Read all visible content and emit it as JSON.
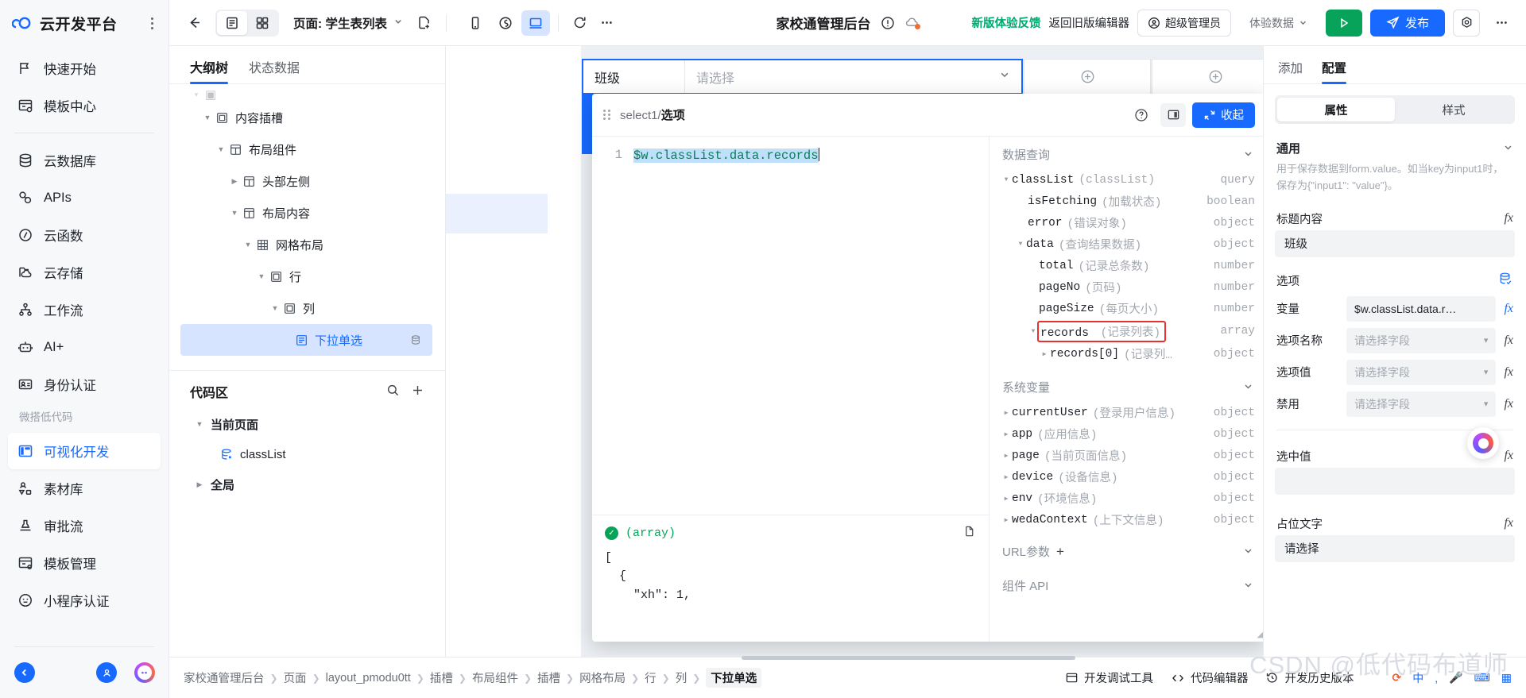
{
  "rail": {
    "brand": "云开发平台",
    "items": [
      {
        "label": "快速开始",
        "icon": "flag-icon"
      },
      {
        "label": "模板中心",
        "icon": "template-icon"
      },
      {
        "label": "云数据库",
        "icon": "database-icon"
      },
      {
        "label": "APIs",
        "icon": "api-link-icon"
      },
      {
        "label": "云函数",
        "icon": "function-icon"
      },
      {
        "label": "云存储",
        "icon": "storage-icon"
      },
      {
        "label": "工作流",
        "icon": "workflow-icon"
      },
      {
        "label": "AI+",
        "icon": "robot-icon"
      },
      {
        "label": "身份认证",
        "icon": "id-card-icon"
      }
    ],
    "group_label": "微搭低代码",
    "lowcode_items": [
      {
        "label": "可视化开发",
        "icon": "layout-icon",
        "active": true
      },
      {
        "label": "素材库",
        "icon": "assets-icon",
        "active": false
      },
      {
        "label": "审批流",
        "icon": "approval-icon",
        "active": false
      },
      {
        "label": "模板管理",
        "icon": "template-manage-icon",
        "active": false
      },
      {
        "label": "小程序认证",
        "icon": "miniprogram-icon",
        "active": false
      }
    ]
  },
  "topbar": {
    "back": "back-arrow",
    "page_label": "页面: 学生表列表",
    "app_title": "家校通管理后台",
    "feedback": "新版体验反馈",
    "old_editor": "返回旧版编辑器",
    "role": "超级管理员",
    "env": "体验数据",
    "publish": "发布"
  },
  "outline": {
    "tabs": [
      {
        "label": "大纲树",
        "active": true
      },
      {
        "label": "状态数据",
        "active": false
      }
    ],
    "nodes": [
      {
        "label": "内容插槽",
        "indent": 2,
        "caret": "down",
        "icon": "slot-icon",
        "selected": false
      },
      {
        "label": "布局组件",
        "indent": 3,
        "caret": "down",
        "icon": "layout-icon",
        "selected": false
      },
      {
        "label": "头部左侧",
        "indent": 4,
        "caret": "right",
        "icon": "layout-icon",
        "selected": false
      },
      {
        "label": "布局内容",
        "indent": 4,
        "caret": "down",
        "icon": "layout-icon",
        "selected": false
      },
      {
        "label": "网格布局",
        "indent": 5,
        "caret": "down",
        "icon": "grid-icon",
        "selected": false
      },
      {
        "label": "行",
        "indent": 6,
        "caret": "down",
        "icon": "row-icon",
        "selected": false
      },
      {
        "label": "列",
        "indent": 7,
        "caret": "down",
        "icon": "col-icon",
        "selected": false
      },
      {
        "label": "下拉单选",
        "indent": 8,
        "caret": "none",
        "icon": "select-icon",
        "selected": true
      }
    ],
    "code_section": {
      "title": "代码区",
      "search_icon": "search-icon",
      "add_icon": "plus-icon",
      "groups": [
        {
          "label": "当前页面",
          "caret": "down",
          "bold": true
        },
        {
          "label": "classList",
          "caret": "none",
          "bold": false,
          "icon": "query-icon"
        },
        {
          "label": "全局",
          "caret": "right",
          "bold": true
        }
      ]
    }
  },
  "canvas": {
    "field_label": "班级",
    "field_placeholder": "请选择",
    "add_icon": "plus-circle-icon"
  },
  "modal": {
    "title_prefix": "select1",
    "title_sep": "/",
    "title_main": "选项",
    "help_icon": "question-icon",
    "dock_icon": "panel-icon",
    "collapse_label": "收起",
    "code_line_no": "1",
    "code_text": "$w.classList.data.records",
    "result": {
      "status_icon": "check-icon",
      "type_label": "(array)",
      "copy_icon": "copy-icon",
      "json": "[\n  {\n    \"xh\": 1,"
    },
    "vars": {
      "section_query": "数据查询",
      "section_system": "系统变量",
      "section_url": "URL参数",
      "section_api": "组件 API",
      "query_rows": [
        {
          "name": "classList",
          "desc": "(classList)",
          "type": "query",
          "indent": 1,
          "caret": "down",
          "highlight": false
        },
        {
          "name": "isFetching",
          "desc": "(加载状态)",
          "type": "boolean",
          "indent": 2,
          "caret": "none",
          "highlight": false
        },
        {
          "name": "error",
          "desc": "(错误对象)",
          "type": "object",
          "indent": 2,
          "caret": "none",
          "highlight": false
        },
        {
          "name": "data",
          "desc": "(查询结果数据)",
          "type": "object",
          "indent": 2,
          "caret": "down",
          "highlight": false
        },
        {
          "name": "total",
          "desc": "(记录总条数)",
          "type": "number",
          "indent": 3,
          "caret": "none",
          "highlight": false
        },
        {
          "name": "pageNo",
          "desc": "(页码)",
          "type": "number",
          "indent": 3,
          "caret": "none",
          "highlight": false
        },
        {
          "name": "pageSize",
          "desc": "(每页大小)",
          "type": "number",
          "indent": 3,
          "caret": "none",
          "highlight": false
        },
        {
          "name": "records",
          "desc": "(记录列表)",
          "type": "array",
          "indent": 3,
          "caret": "down",
          "highlight": true
        },
        {
          "name": "records[0]",
          "desc": "(记录列…",
          "type": "object",
          "indent": 4,
          "caret": "right",
          "highlight": false
        }
      ],
      "system_rows": [
        {
          "name": "currentUser",
          "desc": "(登录用户信息)",
          "type": "object",
          "caret": "right"
        },
        {
          "name": "app",
          "desc": "(应用信息)",
          "type": "object",
          "caret": "right"
        },
        {
          "name": "page",
          "desc": "(当前页面信息)",
          "type": "object",
          "caret": "right"
        },
        {
          "name": "device",
          "desc": "(设备信息)",
          "type": "object",
          "caret": "right"
        },
        {
          "name": "env",
          "desc": "(环境信息)",
          "type": "object",
          "caret": "right"
        },
        {
          "name": "wedaContext",
          "desc": "(上下文信息)",
          "type": "object",
          "caret": "right"
        }
      ]
    }
  },
  "rightp": {
    "tabs": [
      {
        "label": "添加",
        "active": false
      },
      {
        "label": "配置",
        "active": true
      }
    ],
    "seg": [
      {
        "label": "属性",
        "active": true
      },
      {
        "label": "样式",
        "active": false
      }
    ],
    "section_general": "通用",
    "hint": "用于保存数据到form.value。如当key为input1时，保存为{\"input1\": \"value\"}。",
    "fields": [
      {
        "label": "标题内容",
        "value": "班级",
        "type": "text",
        "fx": "fx"
      },
      {
        "label": "选项",
        "value": "",
        "type": "header",
        "icon": "database-check-icon"
      },
      {
        "label": "变量",
        "value": "$w.classList.data.r…",
        "type": "inline",
        "fx": "fx"
      },
      {
        "label": "选项名称",
        "value": "请选择字段",
        "type": "inline-select",
        "placeholder": true,
        "fx": "fx"
      },
      {
        "label": "选项值",
        "value": "请选择字段",
        "type": "inline-select",
        "placeholder": true,
        "fx": "fx"
      },
      {
        "label": "禁用",
        "value": "请选择字段",
        "type": "inline-select",
        "placeholder": true,
        "fx": "fx"
      },
      {
        "label": "选中值",
        "value": "",
        "type": "text",
        "fx": "fx"
      },
      {
        "label": "占位文字",
        "value": "请选择",
        "type": "text",
        "fx": "fx"
      }
    ]
  },
  "bottom": {
    "crumbs": [
      "家校通管理后台",
      "页面",
      "layout_pmodu0tt",
      "插槽",
      "布局组件",
      "插槽",
      "网格布局",
      "行",
      "列",
      "下拉单选"
    ],
    "tools": [
      {
        "label": "开发调试工具",
        "icon": "debug-icon"
      },
      {
        "label": "代码编辑器",
        "icon": "code-icon"
      },
      {
        "label": "开发历史版本",
        "icon": "history-icon"
      }
    ],
    "watermark": "CSDN @低代码布道师"
  }
}
